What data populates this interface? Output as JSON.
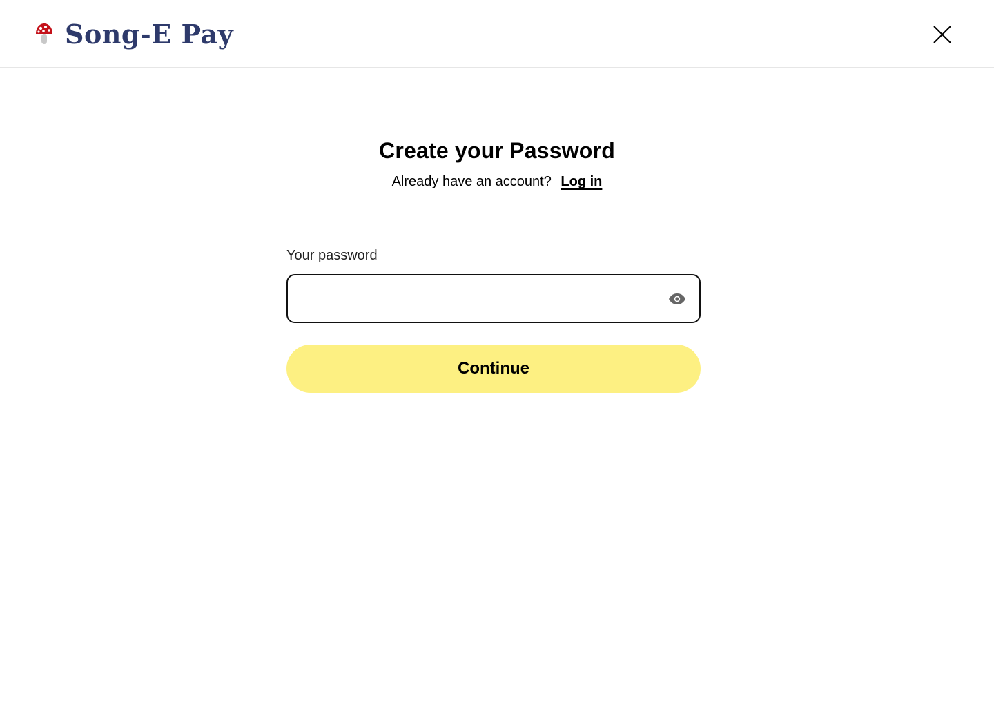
{
  "header": {
    "brand_name": "Song-E Pay",
    "logo_icon": "mushroom-icon",
    "close_icon": "close-icon"
  },
  "main": {
    "title": "Create your Password",
    "account_prompt": "Already have an account?",
    "login_link": "Log in",
    "password_label": "Your password",
    "password_value": "",
    "password_placeholder": "",
    "visibility_icon": "eye-icon",
    "continue_label": "Continue"
  },
  "colors": {
    "brand_text": "#2e3a6b",
    "button_bg": "#fdf082",
    "mushroom_cap": "#c4121a",
    "icon_gray": "#666666"
  }
}
